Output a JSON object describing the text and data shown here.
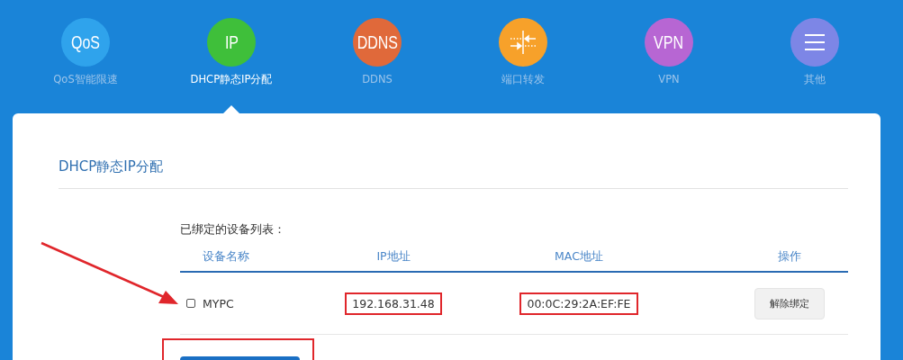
{
  "nav": [
    {
      "kind": "text",
      "icon_text": "QoS",
      "label": "QoS智能限速",
      "color": "#2fa3ec",
      "selected": false
    },
    {
      "kind": "text",
      "icon_text": "IP",
      "label": "DHCP静态IP分配",
      "color": "#3fbf3a",
      "selected": true
    },
    {
      "kind": "text",
      "icon_text": "DDNS",
      "label": "DDNS",
      "color": "#e0693a",
      "selected": false
    },
    {
      "kind": "ports",
      "label": "端口转发",
      "color": "#f7a12a",
      "selected": false
    },
    {
      "kind": "text",
      "icon_text": "VPN",
      "label": "VPN",
      "color": "#b766d3",
      "selected": false
    },
    {
      "kind": "menu",
      "label": "其他",
      "color": "#7d86e6",
      "selected": false
    }
  ],
  "panel": {
    "title": "DHCP静态IP分配",
    "list_label": "已绑定的设备列表：",
    "table": {
      "columns": [
        "设备名称",
        "IP地址",
        "MAC地址",
        "操作"
      ],
      "rows": [
        {
          "checked": false,
          "name": "MYPC",
          "ip": "192.168.31.48",
          "ip_highlighted": true,
          "mac": "00:0C:29:2A:EF:FE",
          "mac_highlighted": true,
          "action": "解除绑定"
        }
      ]
    },
    "bottom_button": {
      "highlighted": true
    }
  },
  "annotation": {
    "arrow": true
  }
}
